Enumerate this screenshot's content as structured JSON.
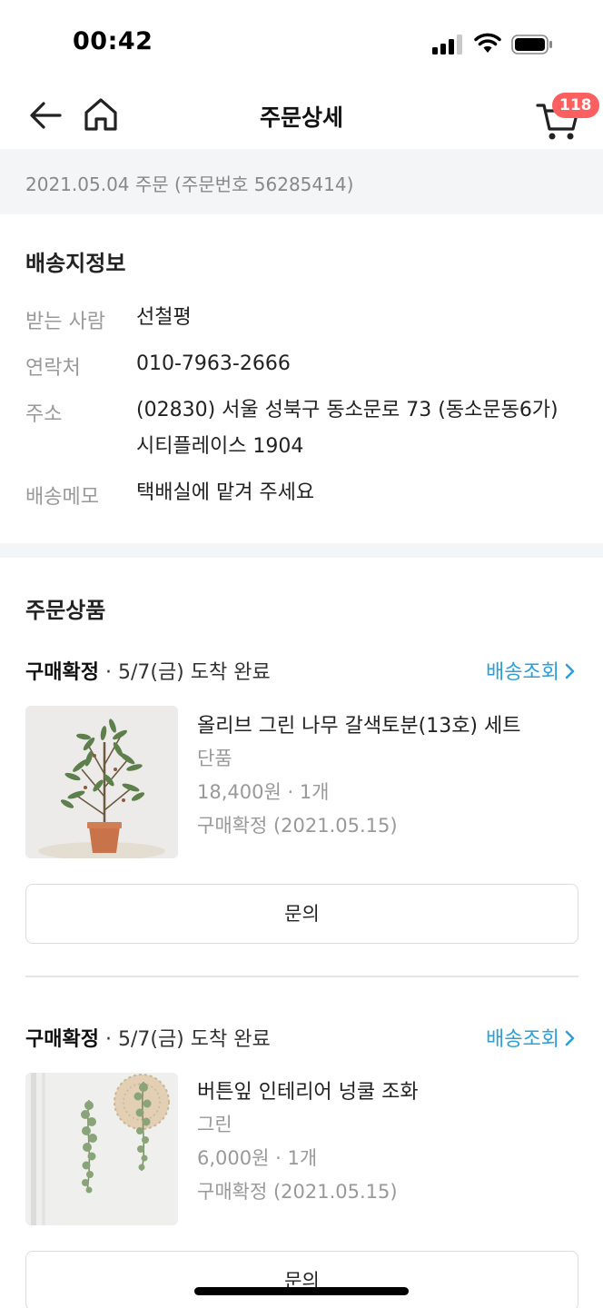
{
  "status_bar": {
    "time": "00:42"
  },
  "nav": {
    "title": "주문상세",
    "cart_count": "118"
  },
  "order_strip": {
    "text": "2021.05.04 주문 (주문번호 56285414)"
  },
  "shipping": {
    "title": "배송지정보",
    "rows": [
      {
        "label": "받는 사람",
        "value": "선철평"
      },
      {
        "label": "연락처",
        "value": "010-7963-2666"
      },
      {
        "label": "주소",
        "value": "(02830) 서울 성북구 동소문로 73 (동소문동6가)",
        "value2": "시티플레이스 1904"
      },
      {
        "label": "배송메모",
        "value": "택배실에 맡겨 주세요"
      }
    ]
  },
  "products_section": {
    "title": "주문상품",
    "items": [
      {
        "status_bold": "구매확정",
        "status_rest": " · 5/7(금) 도착 완료",
        "track_label": "배송조회",
        "name": "올리브 그린 나무 갈색토분(13호) 세트",
        "option": "단품",
        "price_qty": "18,400원 · 1개",
        "confirm": "구매확정 (2021.05.15)",
        "thumb_icon": "olive-tree-image",
        "inquiry_label": "문의"
      },
      {
        "status_bold": "구매확정",
        "status_rest": " · 5/7(금) 도착 완료",
        "track_label": "배송조회",
        "name": "버튼잎 인테리어 넝쿨 조화",
        "option": "그린",
        "price_qty": "6,000원 · 1개",
        "confirm": "구매확정 (2021.05.15)",
        "thumb_icon": "hanging-vine-image",
        "inquiry_label": "문의"
      }
    ]
  },
  "colors": {
    "accent_link": "#2a9fd8",
    "badge": "#fb5f5f",
    "strip_bg": "#f4f5f7"
  }
}
